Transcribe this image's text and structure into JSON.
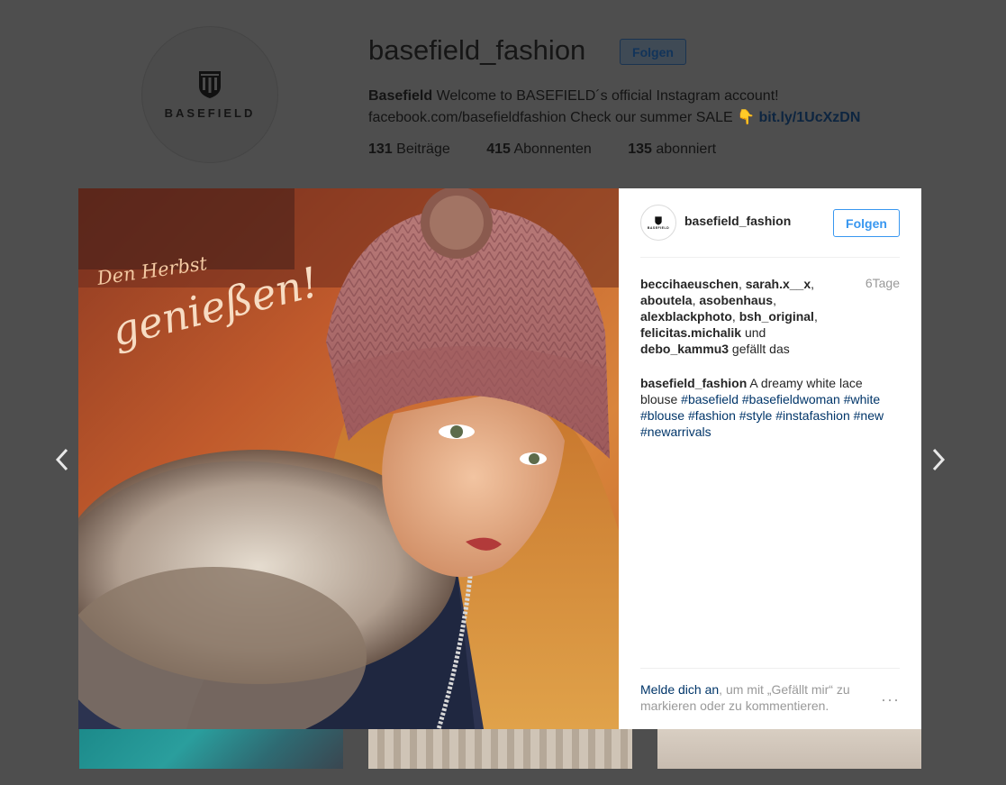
{
  "profile": {
    "username": "basefield_fashion",
    "follow_label": "Folgen",
    "avatar_brand": "BASEFIELD",
    "bio_name": "Basefield",
    "bio_text": " Welcome to BASEFIELD´s official Instagram account! facebook.com/basefieldfashion Check our summer SALE 👇 ",
    "bio_link": "bit.ly/1UcXzDN",
    "stats": {
      "posts_count": "131",
      "posts_label": " Beiträge",
      "followers_count": "415",
      "followers_label": " Abonnenten",
      "following_count": "135",
      "following_label": " abonniert"
    }
  },
  "post": {
    "image_text_line1": "Den Herbst",
    "image_text_line2": "genießen!",
    "header_username": "basefield_fashion",
    "header_follow_label": "Folgen",
    "avatar_brand": "BASEFIELD",
    "likes": {
      "names": [
        "beccihaeuschen",
        "sarah.x__x",
        "aboutela",
        "asobenhaus",
        "alexblackphoto",
        "bsh_original",
        "felicitas.michalik",
        "debo_kammu3"
      ],
      "sep": ", ",
      "and_word": " und ",
      "suffix": " gefällt das"
    },
    "time": "6Tage",
    "caption_user": "basefield_fashion",
    "caption_text": " A dreamy white lace blouse ",
    "hashtags": [
      "#basefield",
      "#basefieldwoman",
      "#white",
      "#blouse",
      "#fashion",
      "#style",
      "#instafashion",
      "#new",
      "#newarrivals"
    ],
    "login_link": "Melde dich an",
    "login_text": ", um mit „Gefällt mir“ zu markieren oder zu kommentieren.",
    "more_icon": "more-dots-icon"
  },
  "nav": {
    "prev_icon": "chevron-left-icon",
    "next_icon": "chevron-right-icon"
  },
  "colors": {
    "link": "#003569",
    "follow_blue": "#3897f0",
    "overlay_bg": "#4e4e4e"
  }
}
